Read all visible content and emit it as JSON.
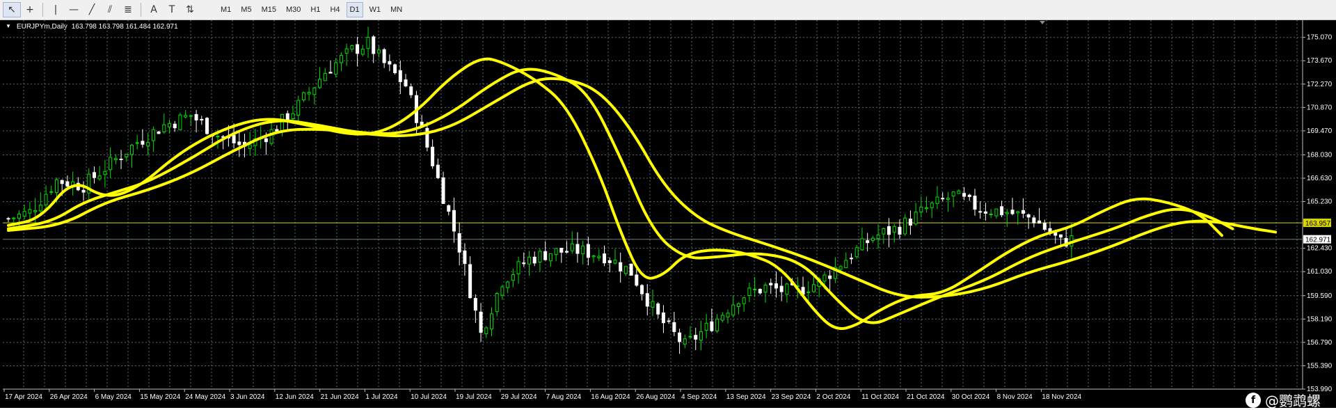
{
  "toolbar": {
    "timeframes": [
      "M1",
      "M5",
      "M15",
      "M30",
      "H1",
      "H4",
      "D1",
      "W1",
      "MN"
    ],
    "active_timeframe": "D1",
    "tools": [
      {
        "name": "cursor-icon",
        "glyph": "↖"
      },
      {
        "name": "crosshair-icon",
        "glyph": "+"
      },
      {
        "name": "vertical-line-icon",
        "glyph": "|"
      },
      {
        "name": "horizontal-line-icon",
        "glyph": "—"
      },
      {
        "name": "trendline-icon",
        "glyph": "╱"
      },
      {
        "name": "channel-icon",
        "glyph": "⫽"
      },
      {
        "name": "fibonacci-icon",
        "glyph": "≣"
      },
      {
        "name": "text-icon",
        "glyph": "A"
      },
      {
        "name": "text-label-icon",
        "glyph": "T"
      },
      {
        "name": "arrows-icon",
        "glyph": "⇅"
      }
    ]
  },
  "chart": {
    "symbol": "EURJPYm,Daily",
    "ohlc_text": "163.798 163.798 161.484 162.971",
    "watermark_text": "@鹦鹉螺",
    "colors": {
      "background": "#000000",
      "grid": "#5a6a6a",
      "bull": "#00e000",
      "bear": "#ffffff",
      "moving_average": "#ffff00",
      "bid_line": "#d8d800",
      "current_line": "#6f8080"
    }
  },
  "chart_data": {
    "type": "candlestick",
    "title": "EURJPYm,Daily",
    "ylim": [
      153.99,
      176.1
    ],
    "y_ticks": [
      "175.070",
      "173.670",
      "172.270",
      "170.870",
      "169.470",
      "168.030",
      "166.630",
      "165.230",
      "162.430",
      "161.030",
      "159.590",
      "158.190",
      "156.790",
      "155.390",
      "153.990"
    ],
    "x_ticks": [
      "17 Apr 2024",
      "26 Apr 2024",
      "6 May 2024",
      "15 May 2024",
      "24 May 2024",
      "3 Jun 2024",
      "12 Jun 2024",
      "21 Jun 2024",
      "1 Jul 2024",
      "10 Jul 2024",
      "19 Jul 2024",
      "29 Jul 2024",
      "7 Aug 2024",
      "16 Aug 2024",
      "26 Aug 2024",
      "4 Sep 2024",
      "13 Sep 2024",
      "23 Sep 2024",
      "2 Oct 2024",
      "11 Oct 2024",
      "21 Oct 2024",
      "30 Oct 2024",
      "8 Nov 2024",
      "18 Nov 2024"
    ],
    "price_labels": [
      {
        "text": "163.957",
        "value": 163.957,
        "kind": "bid"
      },
      {
        "text": "162.971",
        "value": 162.971,
        "kind": "current"
      }
    ],
    "close_anchors": [
      [
        0,
        164.2
      ],
      [
        4,
        164.6
      ],
      [
        9,
        166.5
      ],
      [
        14,
        166.2
      ],
      [
        19,
        167.5
      ],
      [
        24,
        168.8
      ],
      [
        29,
        169.8
      ],
      [
        34,
        170.4
      ],
      [
        39,
        169.2
      ],
      [
        44,
        168.5
      ],
      [
        49,
        169.4
      ],
      [
        54,
        171.0
      ],
      [
        59,
        173.0
      ],
      [
        64,
        174.3
      ],
      [
        67,
        174.7
      ],
      [
        70,
        173.5
      ],
      [
        74,
        172.2
      ],
      [
        79,
        167.6
      ],
      [
        84,
        162.5
      ],
      [
        88,
        157.3
      ],
      [
        92,
        160.5
      ],
      [
        97,
        161.8
      ],
      [
        101,
        162.2
      ],
      [
        106,
        162.3
      ],
      [
        111,
        162.0
      ],
      [
        116,
        161.0
      ],
      [
        121,
        158.3
      ],
      [
        126,
        156.6
      ],
      [
        131,
        157.9
      ],
      [
        136,
        159.5
      ],
      [
        141,
        160.1
      ],
      [
        146,
        159.8
      ],
      [
        151,
        160.4
      ],
      [
        156,
        161.8
      ],
      [
        161,
        163.1
      ],
      [
        166,
        163.7
      ],
      [
        171,
        164.8
      ],
      [
        176,
        165.6
      ],
      [
        181,
        164.8
      ],
      [
        186,
        164.6
      ],
      [
        191,
        164.2
      ],
      [
        196,
        162.8
      ],
      [
        198,
        162.97
      ]
    ],
    "ma_lines": [
      {
        "period": 5,
        "points": [
          [
            0,
            163.8
          ],
          [
            6,
            164.2
          ],
          [
            12,
            166.6
          ],
          [
            18,
            165.4
          ],
          [
            24,
            166.0
          ],
          [
            32,
            168.2
          ],
          [
            40,
            169.6
          ],
          [
            48,
            170.3
          ],
          [
            56,
            169.8
          ],
          [
            64,
            169.2
          ],
          [
            70,
            169.4
          ],
          [
            76,
            170.6
          ],
          [
            82,
            172.6
          ],
          [
            88,
            173.9
          ],
          [
            92,
            173.6
          ],
          [
            98,
            172.6
          ],
          [
            104,
            171.0
          ],
          [
            110,
            167.0
          ],
          [
            114,
            163.4
          ],
          [
            118,
            160.5
          ],
          [
            122,
            160.8
          ],
          [
            126,
            162.1
          ],
          [
            132,
            162.4
          ],
          [
            138,
            162.1
          ],
          [
            144,
            161.3
          ],
          [
            150,
            158.7
          ],
          [
            154,
            157.5
          ],
          [
            158,
            157.8
          ],
          [
            162,
            158.7
          ],
          [
            168,
            159.6
          ],
          [
            174,
            159.7
          ],
          [
            180,
            160.9
          ],
          [
            186,
            162.2
          ],
          [
            192,
            163.2
          ],
          [
            198,
            163.7
          ],
          [
            204,
            164.7
          ],
          [
            210,
            165.5
          ],
          [
            216,
            165.2
          ],
          [
            222,
            164.5
          ],
          [
            226,
            163.2
          ]
        ]
      },
      {
        "period": 10,
        "points": [
          [
            0,
            163.6
          ],
          [
            8,
            164.0
          ],
          [
            14,
            165.2
          ],
          [
            20,
            165.8
          ],
          [
            26,
            166.4
          ],
          [
            34,
            167.8
          ],
          [
            42,
            169.4
          ],
          [
            50,
            170.2
          ],
          [
            58,
            169.8
          ],
          [
            66,
            169.3
          ],
          [
            74,
            169.3
          ],
          [
            82,
            170.4
          ],
          [
            90,
            172.3
          ],
          [
            96,
            173.3
          ],
          [
            102,
            172.9
          ],
          [
            108,
            171.8
          ],
          [
            114,
            167.9
          ],
          [
            120,
            163.4
          ],
          [
            126,
            161.8
          ],
          [
            132,
            161.9
          ],
          [
            140,
            162.2
          ],
          [
            148,
            161.6
          ],
          [
            154,
            159.4
          ],
          [
            160,
            157.7
          ],
          [
            166,
            158.5
          ],
          [
            174,
            159.6
          ],
          [
            182,
            160.5
          ],
          [
            190,
            161.9
          ],
          [
            198,
            162.8
          ],
          [
            206,
            163.6
          ],
          [
            212,
            164.4
          ],
          [
            218,
            164.9
          ],
          [
            224,
            164.3
          ],
          [
            228,
            163.6
          ]
        ]
      },
      {
        "period": 20,
        "points": [
          [
            0,
            163.5
          ],
          [
            10,
            163.8
          ],
          [
            18,
            165.2
          ],
          [
            26,
            165.9
          ],
          [
            34,
            166.9
          ],
          [
            42,
            168.3
          ],
          [
            50,
            169.5
          ],
          [
            58,
            169.6
          ],
          [
            66,
            169.3
          ],
          [
            74,
            169.1
          ],
          [
            82,
            169.6
          ],
          [
            90,
            171.1
          ],
          [
            98,
            172.6
          ],
          [
            104,
            172.6
          ],
          [
            110,
            171.9
          ],
          [
            116,
            169.6
          ],
          [
            122,
            166.2
          ],
          [
            128,
            164.3
          ],
          [
            134,
            163.4
          ],
          [
            142,
            162.6
          ],
          [
            150,
            161.7
          ],
          [
            158,
            160.6
          ],
          [
            166,
            159.5
          ],
          [
            174,
            159.5
          ],
          [
            182,
            160.0
          ],
          [
            190,
            161.0
          ],
          [
            198,
            161.7
          ],
          [
            206,
            162.6
          ],
          [
            212,
            163.4
          ],
          [
            218,
            164.0
          ],
          [
            224,
            164.1
          ],
          [
            232,
            163.6
          ],
          [
            236,
            163.4
          ]
        ]
      }
    ]
  }
}
